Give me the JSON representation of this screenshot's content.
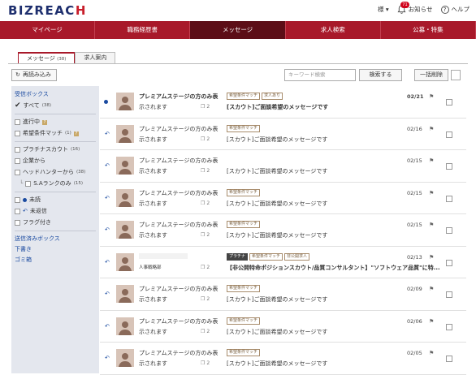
{
  "logo": {
    "main": "BIZREAC",
    "tail": "H"
  },
  "header": {
    "user": "様 ▾",
    "notify_label": "お知らせ",
    "notify_count": "71",
    "help_label": "ヘルプ"
  },
  "nav": [
    "マイページ",
    "職務経歴書",
    "メッセージ",
    "求人検索",
    "公募・特集"
  ],
  "tabs": {
    "messages": "メッセージ",
    "messages_count": "(38)",
    "jobs": "求人案内"
  },
  "toolbar": {
    "reload": "再読み込み",
    "keyword_placeholder": "キーワード検索",
    "search": "検索する",
    "bulk_delete": "一括削除"
  },
  "sidebar": {
    "inbox": "受信ボックス",
    "all": "すべて",
    "all_count": "(38)",
    "in_progress": "進行中",
    "match": "希望条件マッチ",
    "match_count": "(1)",
    "platinum": "プラチナスカウト",
    "platinum_count": "(16)",
    "company": "企業から",
    "headhunter": "ヘッドハンターから",
    "headhunter_count": "(38)",
    "srank": "S.Aランクのみ",
    "srank_count": "(15)",
    "unread": "未読",
    "unreplied": "未返信",
    "flagged": "フラグ付き",
    "sent": "送信済みボックス",
    "drafts": "下書き",
    "trash": "ゴミ箱"
  },
  "rows": [
    {
      "company": "プレミアムステージの方のみ表",
      "sender": "示されます",
      "tags": [
        "希望条件マッチ",
        "求人あり"
      ],
      "subject": "[スカウト]ご面談希望のメッセージです",
      "date": "02/21",
      "count": "2",
      "unread": true
    },
    {
      "company": "プレミアムステージの方のみ表",
      "sender": "示されます",
      "tags": [
        "希望条件マッチ"
      ],
      "subject": "[スカウト]ご面談希望のメッセージです",
      "date": "02/16",
      "count": "2"
    },
    {
      "company": "プレミアムステージの方のみ表",
      "sender": "示されます",
      "tags": [],
      "subject": "[スカウト]ご面談希望のメッセージです",
      "date": "02/15",
      "count": "2"
    },
    {
      "company": "プレミアムステージの方のみ表",
      "sender": "示されます",
      "tags": [
        "希望条件マッチ"
      ],
      "subject": "[スカウト]ご面談希望のメッセージです",
      "date": "02/15",
      "count": "2"
    },
    {
      "company": "プレミアムステージの方のみ表",
      "sender": "示されます",
      "tags": [
        "希望条件マッチ"
      ],
      "subject": "[スカウト]ご面談希望のメッセージです",
      "date": "02/15",
      "count": "2"
    },
    {
      "company": "",
      "sender": "人事戦略部",
      "tags": [
        "プラチナ",
        "希望条件マッチ",
        "非公開求人"
      ],
      "subject": "【非公開特命ポジションスカウト/品質コンサルタント】\"ソフトウェア品質\"に特...",
      "date": "02/13",
      "count": "2"
    },
    {
      "company": "プレミアムステージの方のみ表",
      "sender": "示されます",
      "tags": [
        "希望条件マッチ"
      ],
      "subject": "[スカウト]ご面談希望のメッセージです",
      "date": "02/09",
      "count": "2"
    },
    {
      "company": "プレミアムステージの方のみ表",
      "sender": "示されます",
      "tags": [
        "希望条件マッチ"
      ],
      "subject": "[スカウト]ご面談希望のメッセージです",
      "date": "02/06",
      "count": "2"
    },
    {
      "company": "プレミアムステージの方のみ表",
      "sender": "示されます",
      "tags": [
        "希望条件マッチ"
      ],
      "subject": "[スカウト]ご面談希望のメッセージです",
      "date": "02/05",
      "count": "2"
    }
  ]
}
